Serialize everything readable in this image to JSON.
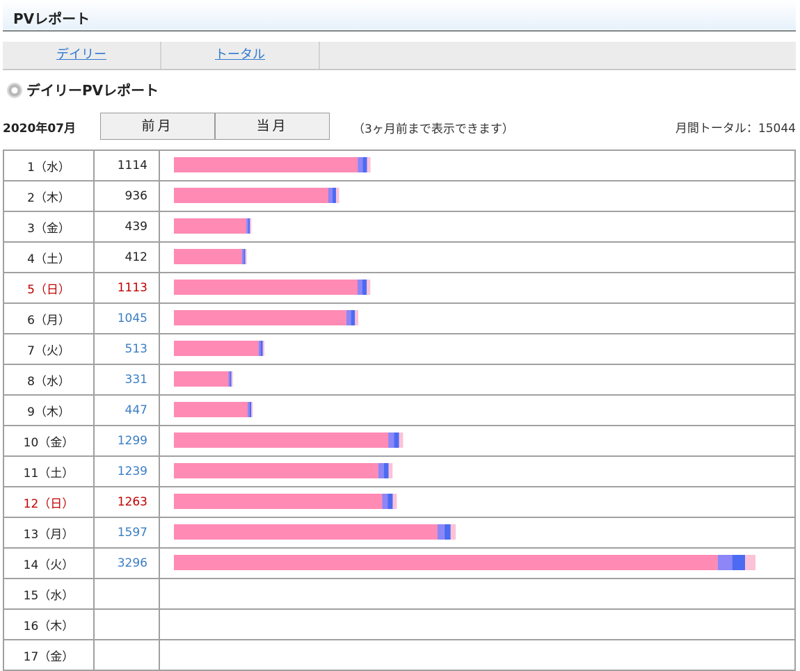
{
  "header": {
    "title": "PVレポート"
  },
  "tabs": [
    {
      "label": "デイリー"
    },
    {
      "label": "トータル"
    }
  ],
  "section": {
    "title": "デイリーPVレポート"
  },
  "controls": {
    "month": "2020年07月",
    "prev_label": "前月",
    "current_label": "当月",
    "range_note": "（3ヶ月前まで表示できます）",
    "monthly_total": "月間トータル：15044"
  },
  "colors": {
    "pink": "#ff8ab4",
    "lavender": "#8c86f6",
    "blue": "#4d6af2",
    "light_pink": "#fbc2d8",
    "sunday_text": "#c00000",
    "link_text": "#3a7dc4"
  },
  "rows": [
    {
      "day": "1（水）",
      "count": "1114",
      "style": "plain",
      "pv": 1114
    },
    {
      "day": "2（木）",
      "count": "936",
      "style": "plain",
      "pv": 936
    },
    {
      "day": "3（金）",
      "count": "439",
      "style": "plain",
      "pv": 439
    },
    {
      "day": "4（土）",
      "count": "412",
      "style": "plain",
      "pv": 412
    },
    {
      "day": "5（日）",
      "count": "1113",
      "style": "sunday",
      "pv": 1113
    },
    {
      "day": "6（月）",
      "count": "1045",
      "style": "link",
      "pv": 1045
    },
    {
      "day": "7（火）",
      "count": "513",
      "style": "link",
      "pv": 513
    },
    {
      "day": "8（水）",
      "count": "331",
      "style": "link",
      "pv": 331
    },
    {
      "day": "9（木）",
      "count": "447",
      "style": "link",
      "pv": 447
    },
    {
      "day": "10（金）",
      "count": "1299",
      "style": "link",
      "pv": 1299
    },
    {
      "day": "11（土）",
      "count": "1239",
      "style": "link",
      "pv": 1239
    },
    {
      "day": "12（日）",
      "count": "1263",
      "style": "sunday",
      "pv": 1263
    },
    {
      "day": "13（月）",
      "count": "1597",
      "style": "link",
      "pv": 1597
    },
    {
      "day": "14（火）",
      "count": "3296",
      "style": "link",
      "pv": 3296
    },
    {
      "day": "15（水）",
      "count": "",
      "style": "plain",
      "pv": 0
    },
    {
      "day": "16（木）",
      "count": "",
      "style": "plain",
      "pv": 0
    },
    {
      "day": "17（金）",
      "count": "",
      "style": "plain",
      "pv": 0
    }
  ]
}
